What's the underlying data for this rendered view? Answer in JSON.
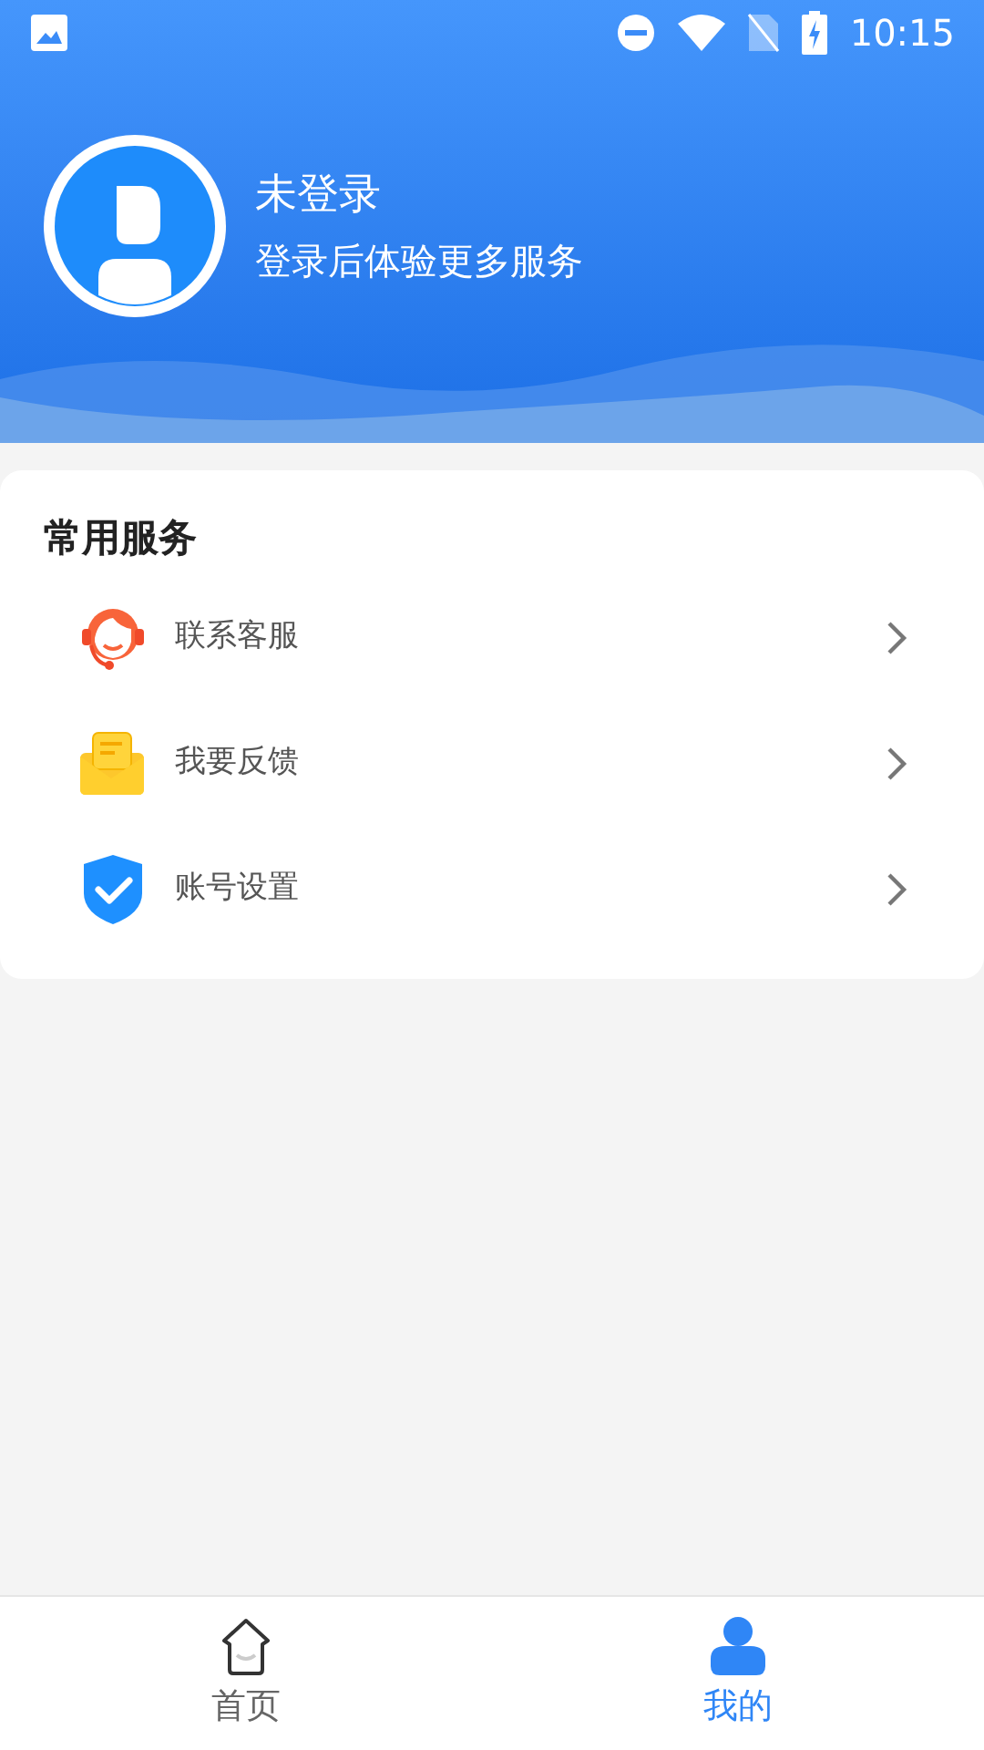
{
  "status_bar": {
    "time": "10:15"
  },
  "profile": {
    "name": "未登录",
    "subtitle": "登录后体验更多服务"
  },
  "services": {
    "title": "常用服务",
    "items": [
      {
        "kind": "headset",
        "label": "联系客服"
      },
      {
        "kind": "mail",
        "label": "我要反馈"
      },
      {
        "kind": "shield",
        "label": "账号设置"
      }
    ]
  },
  "tabs": [
    {
      "kind": "home",
      "label": "首页",
      "selected": false
    },
    {
      "kind": "user",
      "label": "我的",
      "selected": true
    }
  ]
}
